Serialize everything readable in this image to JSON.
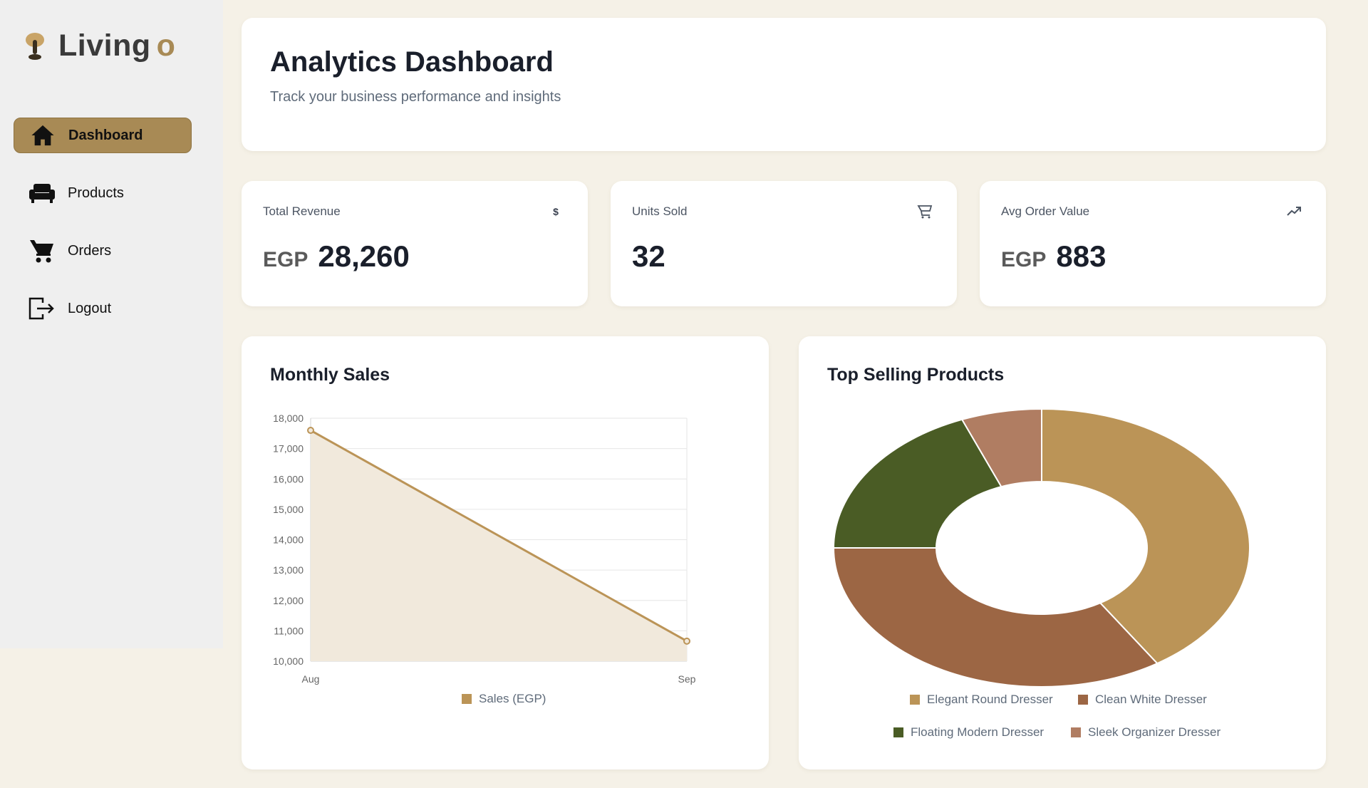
{
  "app": {
    "logo_text": "Living",
    "logo_suffix": "o"
  },
  "sidebar": {
    "items": [
      {
        "label": "Dashboard",
        "icon": "home-icon",
        "active": true
      },
      {
        "label": "Products",
        "icon": "sofa-icon",
        "active": false
      },
      {
        "label": "Orders",
        "icon": "cart-icon",
        "active": false
      },
      {
        "label": "Logout",
        "icon": "logout-icon",
        "active": false
      }
    ]
  },
  "header": {
    "title": "Analytics Dashboard",
    "subtitle": "Track your business performance and insights"
  },
  "stats": [
    {
      "label": "Total Revenue",
      "prefix": "EGP",
      "value": "28,260",
      "icon": "dollar-icon"
    },
    {
      "label": "Units Sold",
      "prefix": "",
      "value": "32",
      "icon": "cart-outline-icon"
    },
    {
      "label": "Avg Order Value",
      "prefix": "EGP",
      "value": "883",
      "icon": "trending-up-icon"
    }
  ],
  "colors": {
    "accent": "#a88a55",
    "line": "#bb9457",
    "fill": "#f1e9dc",
    "pie": [
      "#bb9457",
      "#9c6644",
      "#4a5c25",
      "#b07d62"
    ]
  },
  "monthly_sales": {
    "title": "Monthly Sales",
    "legend": "Sales (EGP)"
  },
  "top_products": {
    "title": "Top Selling Products"
  },
  "chart_data": [
    {
      "type": "area",
      "title": "Monthly Sales",
      "categories": [
        "Aug",
        "Sep"
      ],
      "series": [
        {
          "name": "Sales (EGP)",
          "values": [
            17600,
            10660
          ]
        }
      ],
      "ylim": [
        10000,
        18000
      ],
      "yticks": [
        "18,000",
        "17,000",
        "16,000",
        "15,000",
        "14,000",
        "13,000",
        "12,000",
        "11,000",
        "10,000"
      ],
      "grid": true,
      "legend": "bottom"
    },
    {
      "type": "pie",
      "title": "Top Selling Products",
      "donut": true,
      "labels": [
        "Elegant Round Dresser",
        "Clean White Dresser",
        "Floating Modern Dresser",
        "Sleek Organizer Dresser"
      ],
      "values": [
        13,
        11,
        6,
        2
      ],
      "legend": "bottom"
    }
  ]
}
